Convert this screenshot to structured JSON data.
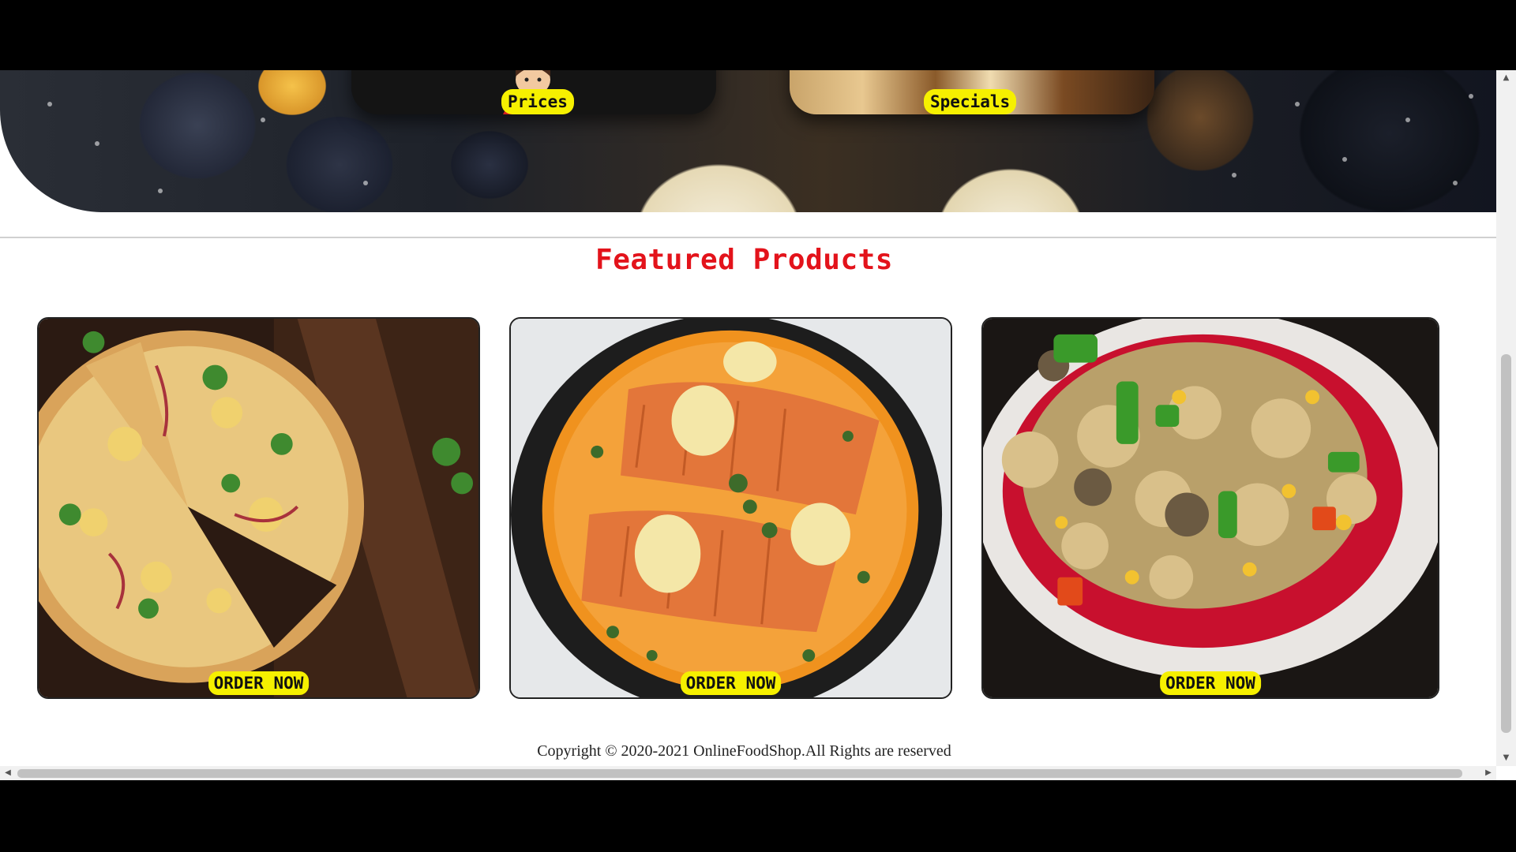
{
  "nav": {
    "items": [
      {
        "label": "Prices"
      },
      {
        "label": "Specials"
      }
    ]
  },
  "featured": {
    "title": "Featured Products",
    "products": [
      {
        "image": "pizza-image",
        "button_label": "ORDER NOW"
      },
      {
        "image": "salmon-curry-image",
        "button_label": "ORDER NOW"
      },
      {
        "image": "veggie-pizza-image",
        "button_label": "ORDER NOW"
      }
    ]
  },
  "footer": {
    "copyright": "Copyright © 2020-2021 OnlineFoodShop.All Rights are reserved"
  },
  "colors": {
    "title_red": "#e3131b",
    "button_yellow": "#f6f000"
  }
}
